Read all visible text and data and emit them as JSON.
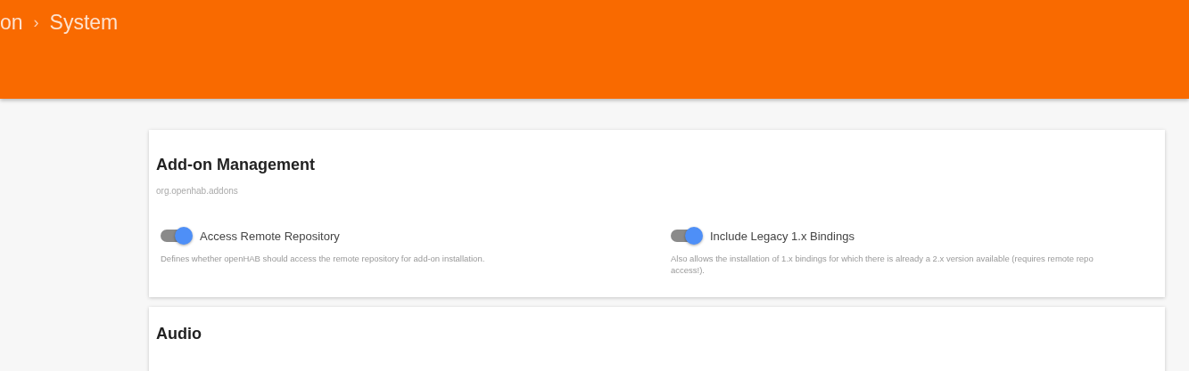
{
  "breadcrumb": [
    "on",
    "›",
    "System"
  ],
  "sections": [
    {
      "title": "Add-on Management",
      "subtitle": "org.openhab.addons",
      "settings": [
        {
          "label": "Access Remote Repository",
          "checked": true,
          "description": "Defines whether openHAB should access the remote repository for add-on installation."
        },
        {
          "label": "Include Legacy 1.x Bindings",
          "checked": true,
          "description": "Also allows the installation of 1.x bindings for which there is already a 2.x version available (requires remote repo access!)."
        }
      ]
    },
    {
      "title": "Audio"
    }
  ]
}
